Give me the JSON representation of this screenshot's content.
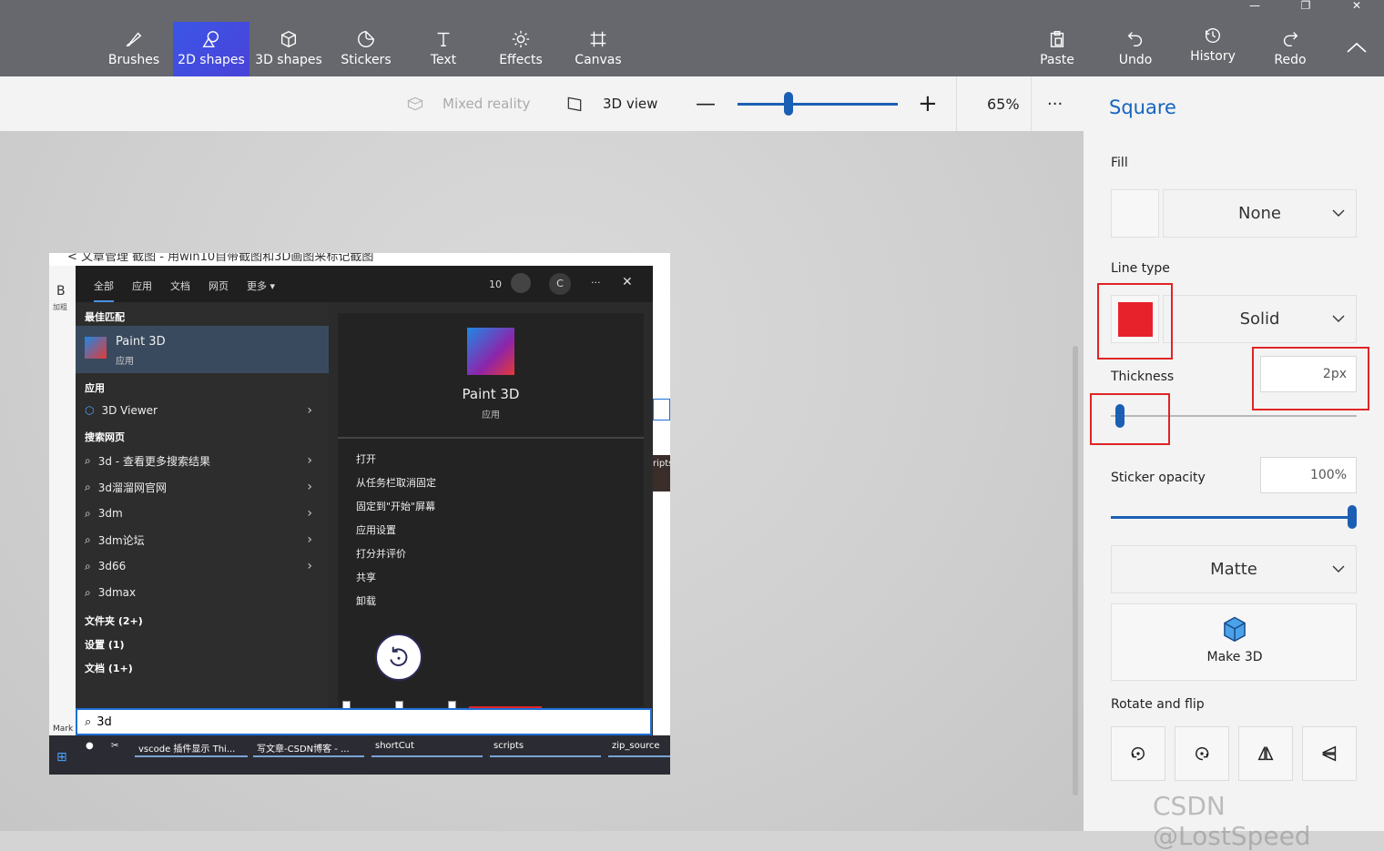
{
  "toolbar": {
    "tools": [
      {
        "label": "Brushes",
        "icon": "brush-icon"
      },
      {
        "label": "2D shapes",
        "icon": "2d-shapes-icon",
        "active": true
      },
      {
        "label": "3D shapes",
        "icon": "3d-shapes-icon"
      },
      {
        "label": "Stickers",
        "icon": "stickers-icon"
      },
      {
        "label": "Text",
        "icon": "text-icon"
      },
      {
        "label": "Effects",
        "icon": "effects-icon"
      },
      {
        "label": "Canvas",
        "icon": "canvas-icon"
      }
    ],
    "actions": [
      {
        "label": "Paste",
        "icon": "paste-icon"
      },
      {
        "label": "Undo",
        "icon": "undo-icon"
      },
      {
        "label": "History",
        "icon": "history-icon"
      },
      {
        "label": "Redo",
        "icon": "redo-icon"
      }
    ],
    "active_color": "#3b55e6"
  },
  "subbar": {
    "mixed_reality": "Mixed reality",
    "view_3d": "3D view",
    "zoom_level": "65%",
    "zoom_fraction": 0.31,
    "more": "···"
  },
  "panel": {
    "title": "Square",
    "fill_label": "Fill",
    "fill_value": "None",
    "line_type_label": "Line type",
    "line_color": "#e8222a",
    "line_type_value": "Solid",
    "thickness_label": "Thickness",
    "thickness_value": "2px",
    "thickness_fraction": 0.02,
    "sticker_opacity_label": "Sticker opacity",
    "sticker_opacity_value": "100%",
    "sticker_opacity_fraction": 1.0,
    "finish_value": "Matte",
    "make3d_label": "Make 3D",
    "rotate_flip_label": "Rotate and flip",
    "accent": "#1565c0"
  },
  "shot": {
    "title_text": "< 文章管理    截图 - 用win10自带截图和3D画图来标记截图",
    "left_letter": "B",
    "left_sub": "加粗",
    "tabs": [
      "全部",
      "应用",
      "文档",
      "网页",
      "更多 ▾"
    ],
    "top_count": "10",
    "top_avatar": "C",
    "best_match": "最佳匹配",
    "app_name": "Paint 3D",
    "app_type": "应用",
    "apps_head": "应用",
    "viewer": "3D Viewer",
    "web_head": "搜索网页",
    "web_items": [
      "3d - 查看更多搜索结果",
      "3d溜溜网官网",
      "3dm",
      "3dm论坛",
      "3d66",
      "3dmax"
    ],
    "folders": "文件夹 (2+)",
    "settings": "设置 (1)",
    "docs": "文档 (1+)",
    "right_app": "Paint 3D",
    "right_type": "应用",
    "right_actions": [
      "打开",
      "从任务栏取消固定",
      "固定到\"开始\"屏幕",
      "应用设置",
      "打分并评价",
      "共享",
      "卸载"
    ],
    "search_text": "3d",
    "taskbar_items": [
      "vscode 插件显示 Thi...",
      "写文章-CSDN博客 - ...",
      "shortCut",
      "scripts",
      "zip_source"
    ],
    "side_text": "ripts",
    "mark_text": "Mark"
  },
  "watermark": "CSDN @LostSpeed"
}
